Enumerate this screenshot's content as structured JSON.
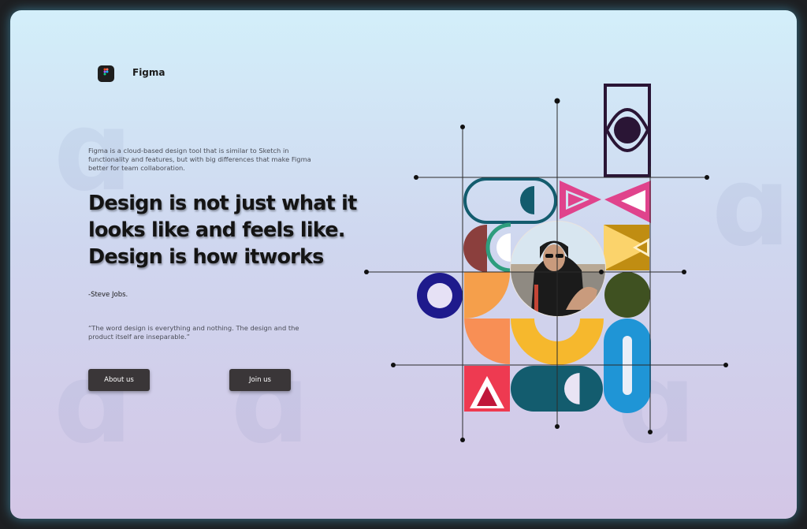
{
  "brand": {
    "name": "Figma",
    "logo_icon": "figma-logo-icon"
  },
  "intro_text": "Figma is a cloud-based design tool that is similar to Sketch in functionality and features, but with big differences that make Figma better for team collaboration.",
  "headline": "Design is not just what it looks like and feels like. Design is how itworks",
  "author": "-Steve Jobs.",
  "quote": "“The word design is everything and nothing. The design and the product itself are inseparable.”",
  "buttons": {
    "about_label": "About us",
    "join_label": "Join us"
  },
  "colors": {
    "background_top": "#d3effa",
    "background_bottom": "#d3c6e6",
    "button": "#3a3638",
    "headline": "#141414",
    "art_teal": "#135c6e",
    "art_pink": "#e0438c",
    "art_orange": "#f59f4b",
    "art_yellow": "#f6b82d",
    "art_blue": "#1f95d6",
    "art_navy": "#1e1a8c",
    "art_olive": "#3f5121",
    "art_mustard": "#c08d12",
    "art_red": "#ee3a51",
    "art_maroon": "#8b3f3d",
    "art_purple_dark": "#2a1535"
  }
}
